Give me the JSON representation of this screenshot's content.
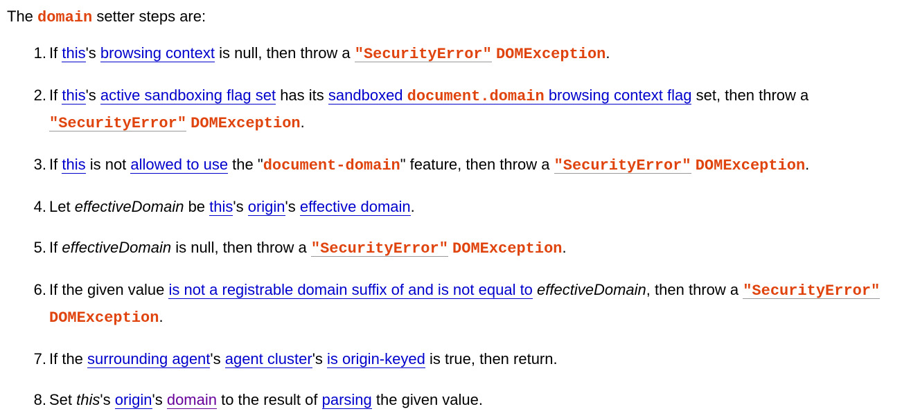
{
  "intro": {
    "prefix": "The ",
    "code": "domain",
    "suffix": " setter steps are:"
  },
  "common": {
    "this": "this",
    "security_error": "\"SecurityError\"",
    "dom_exception": "DOMException",
    "effective_domain_var": "effectiveDomain"
  },
  "steps": [
    {
      "t1": "If ",
      "l1": "browsing context",
      "t2": "'s ",
      "t3": " is null, then throw a ",
      "t4": "."
    },
    {
      "t1": "If ",
      "t2": "'s ",
      "l1": "active sandboxing flag set",
      "t3": " has its ",
      "l2a": "sandboxed ",
      "l2code": "document.domain",
      "l2b": " browsing context flag",
      "t4": " set, then throw a ",
      "t5": "."
    },
    {
      "t1": "If ",
      "t2": " is not ",
      "l1": "allowed to use",
      "t3": " the \"",
      "code": "document-domain",
      "t4": "\" feature, then throw a ",
      "t5": "."
    },
    {
      "t1": "Let ",
      "t2": " be ",
      "t3": "'s ",
      "l1": "origin",
      "t4": "'s ",
      "l2": "effective domain",
      "t5": "."
    },
    {
      "t1": "If ",
      "t2": " is null, then throw a ",
      "t3": "."
    },
    {
      "t1": "If the given value ",
      "l1": "is not a registrable domain suffix of and is not equal to",
      "t2": " ",
      "t3": ", then throw a ",
      "t4": "."
    },
    {
      "t1": "If the ",
      "l1": "surrounding agent",
      "t2": "'s ",
      "l2": "agent cluster",
      "t3": "'s ",
      "l3": "is origin-keyed",
      "t4": " is true, then return."
    },
    {
      "t1": "Set ",
      "t2": "'s ",
      "l1": "origin",
      "t3": "'s ",
      "l2": "domain",
      "t4": " to the result of ",
      "l3": "parsing",
      "t5": " the given value."
    }
  ],
  "colors": {
    "link": "#0000cc",
    "visited_link": "#660099",
    "code": "#e0440e"
  }
}
